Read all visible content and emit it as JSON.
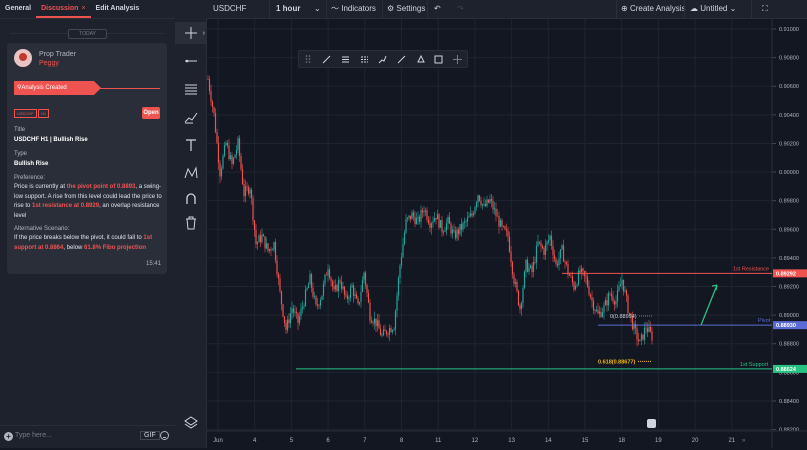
{
  "left_panel": {
    "tabs": {
      "general": "General",
      "discussion": "Discussion",
      "discussion_close": "×",
      "edit": "Edit Analysis"
    },
    "today": "TODAY",
    "post": {
      "author_role": "Prop Trader",
      "author_name": "Peggy",
      "banner": "Analysis Created",
      "badges": [
        "USDCHF",
        "H1"
      ],
      "open_button": "Open",
      "title_label": "Title",
      "title_value": "USDCHF H1 | Bullish Rise",
      "type_label": "Type",
      "type_value": "Bullish Rise",
      "preference_label": "Preference:",
      "preference": {
        "t1": "Price is currently at ",
        "h1": "the pivot point of 0.8893",
        "t2": ", a swing-low support. A rise from this level could lead the price to rise to ",
        "h2": "1st resistance at 0.8929",
        "t3": ", an overlap resistance level"
      },
      "alt_label": "Alternative Scenario:",
      "alt": {
        "t1": "If the price breaks below the pivot, it could fall to ",
        "h1": "1st support at 0.8864",
        "t2": ", below ",
        "h2": "61.8% Fibo projection"
      },
      "time": "15:41"
    },
    "input": {
      "placeholder": "Type here...",
      "gif": "GIF"
    }
  },
  "topbar": {
    "symbol": "USDCHF",
    "interval": "1 hour",
    "indicators": "Indicators",
    "settings": "Settings",
    "create_analysis": "Create Analysis",
    "layout_name": "Untitled"
  },
  "chart_data": {
    "type": "candlestick",
    "symbol": "USDCHF",
    "interval": "1 hour",
    "ylim": [
      0.8819,
      0.9107
    ],
    "y_ticks": [
      "0.91000",
      "0.90800",
      "0.90600",
      "0.90400",
      "0.90200",
      "0.90000",
      "0.89800",
      "0.89600",
      "0.89400",
      "0.89200",
      "0.89000",
      "0.88800",
      "0.88600",
      "0.88400",
      "0.88200"
    ],
    "x_ticks": [
      "Jun",
      "4",
      "5",
      "6",
      "7",
      "8",
      "11",
      "12",
      "13",
      "14",
      "15",
      "18",
      "19",
      "20",
      "21"
    ],
    "levels": [
      {
        "name": "1st Resistance",
        "value": 0.89292,
        "label": "0.89292",
        "color": "#ef5350"
      },
      {
        "name": "Pivot",
        "value": 0.8893,
        "label": "0.88930",
        "color": "#5b6bd5"
      },
      {
        "name": "1st Support",
        "value": 0.88624,
        "label": "0.88624",
        "color": "#26c281"
      }
    ],
    "fib_labels": [
      "0(0.88994)",
      "0.618(0.88677)"
    ],
    "candle_path": [
      [
        0,
        0.9065
      ],
      [
        6,
        0.904
      ],
      [
        12,
        0.9
      ],
      [
        18,
        0.902
      ],
      [
        24,
        0.9005
      ],
      [
        30,
        0.902
      ],
      [
        36,
        0.8985
      ],
      [
        42,
        0.899
      ],
      [
        48,
        0.895
      ],
      [
        54,
        0.8955
      ],
      [
        60,
        0.8945
      ],
      [
        66,
        0.895
      ],
      [
        72,
        0.8915
      ],
      [
        78,
        0.889
      ],
      [
        84,
        0.8905
      ],
      [
        90,
        0.8895
      ],
      [
        96,
        0.891
      ],
      [
        102,
        0.8925
      ],
      [
        108,
        0.8905
      ],
      [
        114,
        0.8915
      ],
      [
        120,
        0.8935
      ],
      [
        126,
        0.8915
      ],
      [
        132,
        0.8925
      ],
      [
        138,
        0.891
      ],
      [
        144,
        0.892
      ],
      [
        150,
        0.8905
      ],
      [
        156,
        0.893
      ],
      [
        162,
        0.89
      ],
      [
        168,
        0.8895
      ],
      [
        174,
        0.8885
      ],
      [
        180,
        0.889
      ],
      [
        186,
        0.8893
      ],
      [
        192,
        0.8935
      ],
      [
        198,
        0.8965
      ],
      [
        204,
        0.897
      ],
      [
        210,
        0.8965
      ],
      [
        216,
        0.8975
      ],
      [
        222,
        0.8965
      ],
      [
        228,
        0.897
      ],
      [
        234,
        0.896
      ],
      [
        240,
        0.8965
      ],
      [
        246,
        0.8955
      ],
      [
        252,
        0.896
      ],
      [
        258,
        0.8965
      ],
      [
        264,
        0.897
      ],
      [
        270,
        0.8985
      ],
      [
        276,
        0.8975
      ],
      [
        282,
        0.898
      ],
      [
        288,
        0.897
      ],
      [
        294,
        0.896
      ],
      [
        300,
        0.8955
      ],
      [
        306,
        0.8925
      ],
      [
        312,
        0.8905
      ],
      [
        318,
        0.8935
      ],
      [
        324,
        0.893
      ],
      [
        330,
        0.895
      ],
      [
        336,
        0.8945
      ],
      [
        342,
        0.8955
      ],
      [
        348,
        0.8935
      ],
      [
        354,
        0.8945
      ],
      [
        360,
        0.893
      ],
      [
        366,
        0.892
      ],
      [
        372,
        0.893
      ],
      [
        378,
        0.8925
      ],
      [
        384,
        0.891
      ],
      [
        390,
        0.89
      ],
      [
        396,
        0.8905
      ],
      [
        402,
        0.8915
      ],
      [
        408,
        0.891
      ],
      [
        414,
        0.8925
      ],
      [
        420,
        0.8905
      ],
      [
        426,
        0.889
      ],
      [
        432,
        0.888
      ],
      [
        438,
        0.8892
      ],
      [
        444,
        0.8885
      ]
    ],
    "grid": true
  }
}
